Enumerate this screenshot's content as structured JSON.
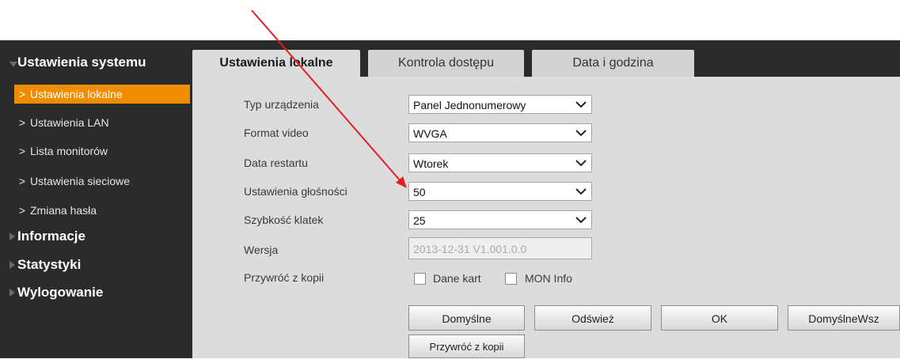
{
  "sidebar": {
    "sections": [
      {
        "label": "Ustawienia systemu",
        "icon": "triangle-down-icon"
      },
      {
        "label": "Informacje",
        "icon": "triangle-right-icon"
      },
      {
        "label": "Statystyki",
        "icon": "triangle-right-icon"
      },
      {
        "label": "Wylogowanie",
        "icon": "triangle-right-icon"
      }
    ],
    "items": [
      {
        "label": "Ustawienia lokalne",
        "active": true
      },
      {
        "label": "Ustawienia LAN"
      },
      {
        "label": "Lista monitorów"
      },
      {
        "label": "Ustawienia sieciowe"
      },
      {
        "label": "Zmiana hasła"
      }
    ]
  },
  "tabs": [
    {
      "label": "Ustawienia lokalne",
      "active": true
    },
    {
      "label": "Kontrola dostępu"
    },
    {
      "label": "Data i godzina"
    }
  ],
  "form": {
    "fields": [
      {
        "label": "Typ urządzenia",
        "value": "Panel Jednonumerowy"
      },
      {
        "label": "Format video",
        "value": "WVGA"
      },
      {
        "label": "Data restartu",
        "value": "Wtorek"
      },
      {
        "label": "Ustawienia głośności",
        "value": "50"
      },
      {
        "label": "Szybkość klatek",
        "value": "25"
      },
      {
        "label": "Wersja",
        "value": "2013-12-31 V1.001.0.0"
      }
    ],
    "restore": {
      "label": "Przywróć z kopii",
      "options": [
        {
          "label": "Dane kart",
          "checked": false
        },
        {
          "label": "MON Info",
          "checked": false
        }
      ]
    }
  },
  "buttons": {
    "default": "Domyślne",
    "refresh": "Odśwież",
    "ok": "OK",
    "default_all": "DomyślneWsz",
    "restore": "Przywróć z kopii"
  },
  "colors": {
    "accent": "#f08c00",
    "annotation_arrow": "#e02020",
    "sidebar_bg": "#2b2b2b",
    "content_bg": "#dcdcdc"
  }
}
